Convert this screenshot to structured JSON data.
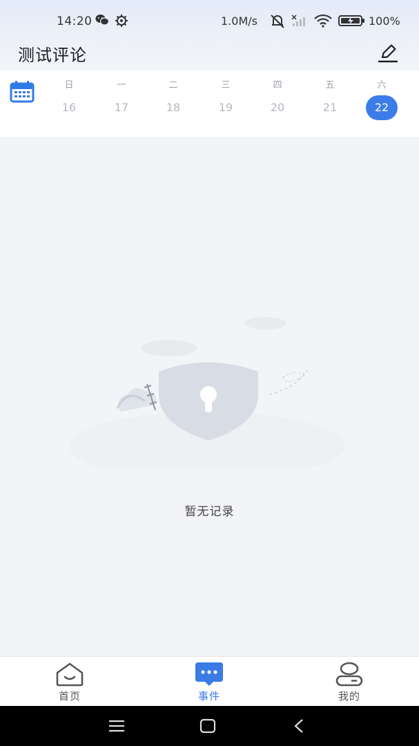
{
  "status_bar": {
    "time": "14:20",
    "net_speed": "1.0M/s",
    "battery": "100%",
    "icons": [
      "wechat-icon",
      "settings-gear-icon",
      "mute-bell-icon",
      "signal-off-icon",
      "wifi-icon",
      "battery-charging-icon"
    ]
  },
  "header": {
    "title": "测试评论",
    "edit_icon": "pencil-edit-icon"
  },
  "calendar": {
    "icon": "calendar-icon",
    "days": [
      {
        "weekday": "日",
        "date": "16",
        "selected": false
      },
      {
        "weekday": "一",
        "date": "17",
        "selected": false
      },
      {
        "weekday": "二",
        "date": "18",
        "selected": false
      },
      {
        "weekday": "三",
        "date": "19",
        "selected": false
      },
      {
        "weekday": "四",
        "date": "20",
        "selected": false
      },
      {
        "weekday": "五",
        "date": "21",
        "selected": false
      },
      {
        "weekday": "六",
        "date": "22",
        "selected": true
      }
    ]
  },
  "empty_state": {
    "illustration": "shield-lock-illustration",
    "text": "暂无记录"
  },
  "bottom_nav": {
    "items": [
      {
        "label": "首页",
        "icon": "home-icon",
        "active": false
      },
      {
        "label": "事件",
        "icon": "chat-bubble-icon",
        "active": true
      },
      {
        "label": "我的",
        "icon": "profile-icon",
        "active": false
      }
    ]
  },
  "colors": {
    "accent": "#3b7ce9",
    "text_primary": "#1d1d1f",
    "text_muted": "#b3b8bf",
    "background": "#f3f4f7"
  }
}
